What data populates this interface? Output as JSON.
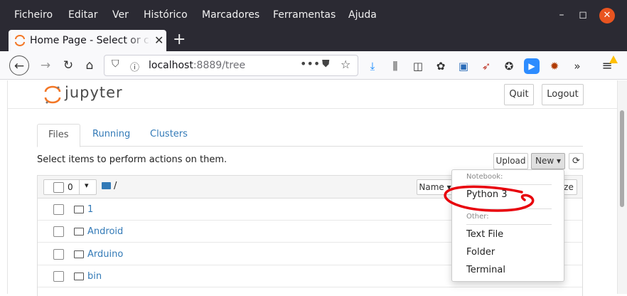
{
  "browser": {
    "menu": [
      {
        "label": "Ficheiro"
      },
      {
        "label": "Editar"
      },
      {
        "label": "Ver"
      },
      {
        "label": "Histórico"
      },
      {
        "label": "Marcadores"
      },
      {
        "label": "Ferramentas"
      },
      {
        "label": "Ajuda"
      }
    ],
    "tab_title": "Home Page - Select or create a notebook",
    "url_host": "localhost",
    "url_rest": ":8889/tree",
    "accent_color": "#e95420"
  },
  "jupyter": {
    "logo_text": "jupyter",
    "quit_label": "Quit",
    "logout_label": "Logout",
    "tabs": [
      {
        "label": "Files"
      },
      {
        "label": "Running"
      },
      {
        "label": "Clusters"
      }
    ],
    "hint": "Select items to perform actions on them.",
    "upload_label": "Upload",
    "new_label": "New",
    "selected_count": "0",
    "path": "/",
    "sort_label": "Name",
    "sort_partial": "ze",
    "files": [
      {
        "name": "1"
      },
      {
        "name": "Android"
      },
      {
        "name": "Arduino"
      },
      {
        "name": "bin"
      }
    ],
    "new_menu": {
      "notebook_header": "Notebook:",
      "python3": "Python 3",
      "other_header": "Other:",
      "text_file": "Text File",
      "folder": "Folder",
      "terminal": "Terminal"
    }
  },
  "colors": {
    "link": "#337ab7",
    "annotation": "#e8000b",
    "jupyter_orange": "#f37726"
  }
}
